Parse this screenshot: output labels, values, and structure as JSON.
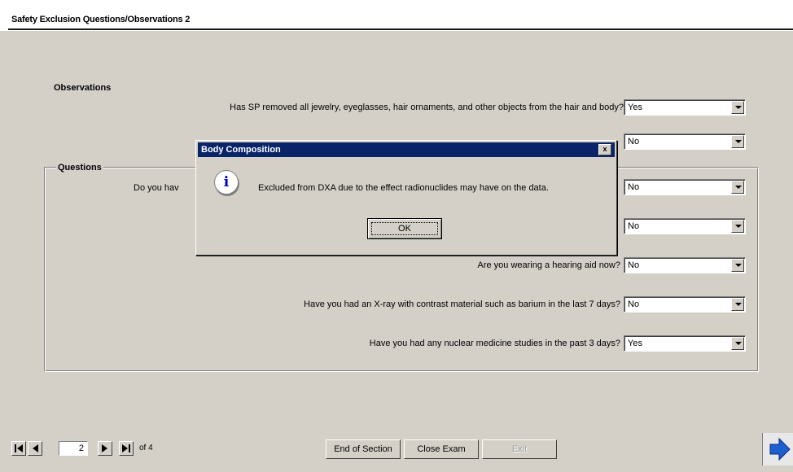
{
  "window": {
    "title": "Safety Exclusion Questions/Observations 2"
  },
  "observations": {
    "heading": "Observations",
    "items": [
      {
        "label": "Has SP removed all jewelry, eyeglasses, hair ornaments, and other objects from the hair and body?",
        "value": "Yes"
      },
      {
        "label": "",
        "value": "No"
      }
    ]
  },
  "questions": {
    "heading": "Questions",
    "items": [
      {
        "label": "Do you hav",
        "value": "No"
      },
      {
        "label": "",
        "value": "No"
      },
      {
        "label": "Are you wearing a hearing aid now?",
        "value": "No"
      },
      {
        "label": "Have you had an X-ray with contrast material such as barium in the last 7 days?",
        "value": "No"
      },
      {
        "label": "Have you had any nuclear medicine studies in the past 3 days?",
        "value": "Yes"
      }
    ]
  },
  "dialog": {
    "title": "Body Composition",
    "close_glyph": "x",
    "icon": "info-icon",
    "icon_glyph": "i",
    "message": "Excluded from DXA due to the effect radionuclides may have on the data.",
    "ok_label": "OK"
  },
  "footer": {
    "page_current": "2",
    "page_of": "of 4",
    "end_of_section_label": "End of Section",
    "close_exam_label": "Close Exam",
    "disabled_label": "Exit"
  }
}
